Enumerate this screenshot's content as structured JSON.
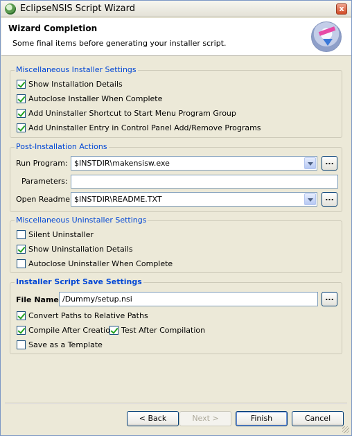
{
  "window": {
    "title": "EclipseNSIS Script Wizard",
    "close_glyph": "x"
  },
  "banner": {
    "title": "Wizard Completion",
    "subtitle": "Some final items before generating your installer script."
  },
  "misc_installer": {
    "legend": "Miscellaneous Installer Settings",
    "options": [
      {
        "label": "Show Installation Details",
        "checked": true
      },
      {
        "label": "Autoclose Installer When Complete",
        "checked": true
      },
      {
        "label": "Add Uninstaller Shortcut to Start Menu Program Group",
        "checked": true
      },
      {
        "label": "Add Uninstaller Entry in Control Panel Add/Remove Programs",
        "checked": true
      }
    ]
  },
  "post_install": {
    "legend": "Post-Installation Actions",
    "run_program_label": "Run Program:",
    "run_program_value": "$INSTDIR\\makensisw.exe",
    "parameters_label": "Parameters:",
    "parameters_value": "",
    "open_readme_label": "Open Readme:",
    "open_readme_value": "$INSTDIR\\README.TXT",
    "browse_label": "..."
  },
  "misc_uninstaller": {
    "legend": "Miscellaneous Uninstaller Settings",
    "options": [
      {
        "label": "Silent Uninstaller",
        "checked": false
      },
      {
        "label": "Show Uninstallation Details",
        "checked": true
      },
      {
        "label": "Autoclose Uninstaller When Complete",
        "checked": false
      }
    ]
  },
  "save_settings": {
    "legend": "Installer Script Save Settings",
    "file_name_label": "File Name:",
    "file_name_value": "/Dummy/setup.nsi",
    "browse_label": "...",
    "options": [
      {
        "label": "Convert Paths to Relative Paths",
        "checked": true
      },
      {
        "label": "Compile After Creation",
        "checked": true
      },
      {
        "label": "Test After Compilation",
        "checked": true
      },
      {
        "label": "Save as a Template",
        "checked": false
      }
    ]
  },
  "buttons": {
    "back": "< Back",
    "next": "Next >",
    "finish": "Finish",
    "cancel": "Cancel"
  },
  "colors": {
    "accent": "#0046d5",
    "check": "#21a121",
    "background": "#ece9d8"
  }
}
